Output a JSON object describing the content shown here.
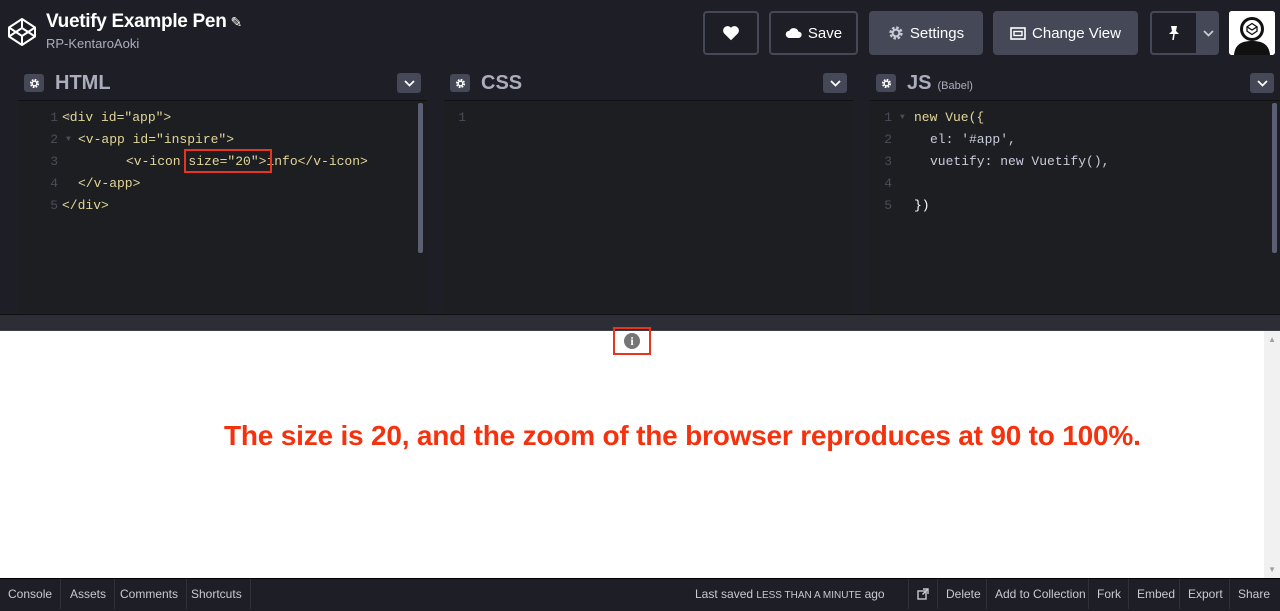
{
  "header": {
    "title": "Vuetify Example Pen",
    "author": "RP-KentaroAoki",
    "buttons": {
      "love_icon": "heart-icon",
      "save_label": "Save",
      "settings_label": "Settings",
      "change_view_label": "Change View",
      "pin_icon": "pin-icon"
    }
  },
  "editors": {
    "html": {
      "label": "HTML",
      "lines": [
        {
          "n": "1",
          "text": "<div id=\"app\">"
        },
        {
          "n": "2",
          "text": "<v-app id=\"inspire\">"
        },
        {
          "n": "3",
          "text": "<v-icon size=\"20\">info</v-icon>"
        },
        {
          "n": "4",
          "text": "</v-app>"
        },
        {
          "n": "5",
          "text": "</div>"
        }
      ]
    },
    "css": {
      "label": "CSS",
      "lines": [
        {
          "n": "1"
        }
      ]
    },
    "js": {
      "label": "JS",
      "sub_label": "(Babel)",
      "lines": [
        {
          "n": "1",
          "text": "new Vue({"
        },
        {
          "n": "2",
          "text": "el: '#app',"
        },
        {
          "n": "3",
          "text": "vuetify: new Vuetify(),"
        },
        {
          "n": "4",
          "text": ""
        },
        {
          "n": "5",
          "text": "})"
        }
      ]
    }
  },
  "preview": {
    "icon_glyph": "i",
    "note": "The size is 20, and the zoom of the browser reproduces at 90 to 100%."
  },
  "footer": {
    "left": [
      "Console",
      "Assets",
      "Comments",
      "Shortcuts"
    ],
    "saved_prefix": "Last saved",
    "saved_caps": "less than a minute",
    "saved_suffix": "ago",
    "right": [
      "Delete",
      "Add to Collection",
      "Fork",
      "Embed",
      "Export",
      "Share"
    ]
  },
  "colors": {
    "accent_red": "#e8351c",
    "background": "#1e1f26",
    "button": "#444857"
  }
}
